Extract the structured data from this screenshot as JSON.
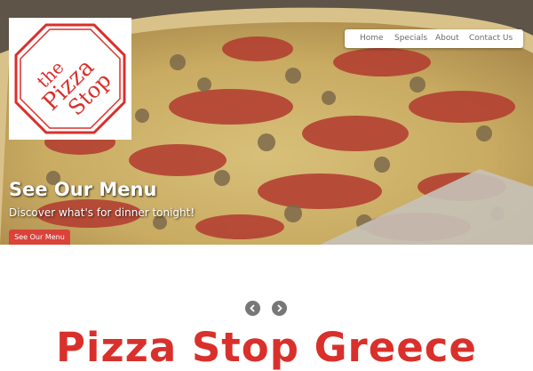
{
  "brand": {
    "logo_alt": "the Pizza Stop",
    "logo_color": "#d9302b"
  },
  "nav": {
    "items": [
      {
        "label": "Home"
      },
      {
        "label": "Specials"
      },
      {
        "label": "About"
      },
      {
        "label": "Contact Us"
      }
    ]
  },
  "hero": {
    "title": "See Our Menu",
    "subtitle": "Discover what's for dinner tonight!",
    "button_label": "See Our Menu",
    "button_color": "#d9433a"
  },
  "slider": {
    "prev_icon": "chevron-left-icon",
    "next_icon": "chevron-right-icon"
  },
  "main": {
    "headline": "Pizza Stop Greece"
  }
}
